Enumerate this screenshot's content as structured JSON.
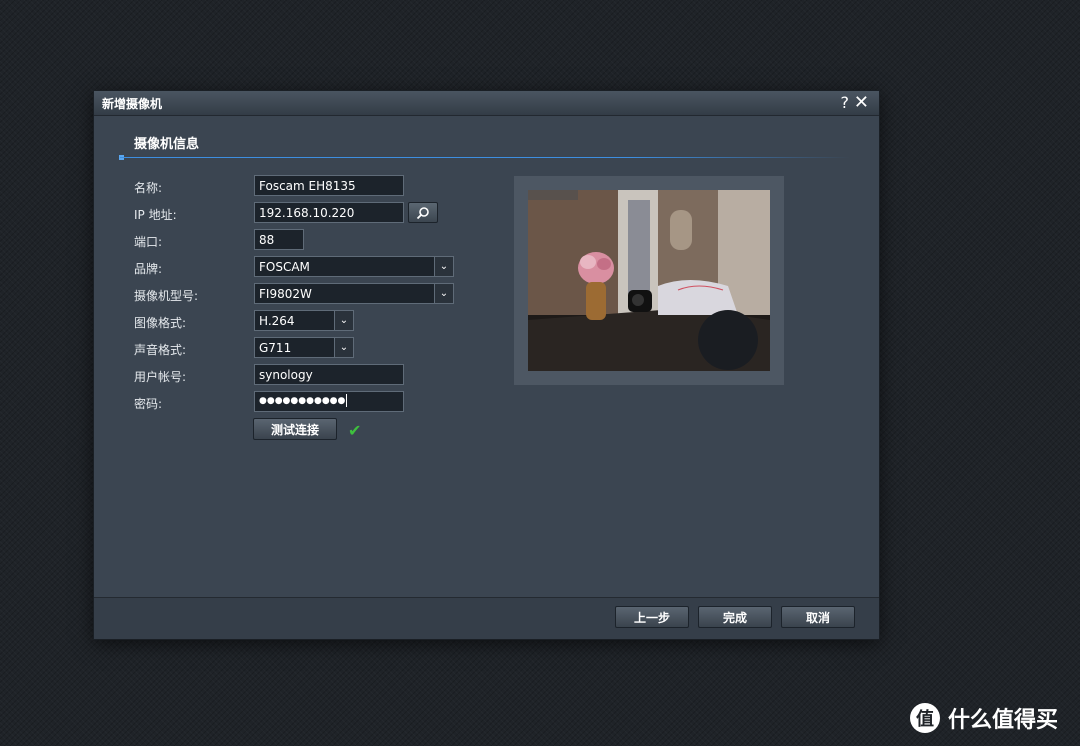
{
  "dialog": {
    "title": "新增摄像机",
    "help_icon": "?",
    "close_icon": "✕"
  },
  "section": {
    "title": "摄像机信息"
  },
  "form": {
    "name_label": "名称:",
    "name_value": "Foscam EH8135",
    "ip_label": "IP 地址:",
    "ip_value": "192.168.10.220",
    "port_label": "端口:",
    "port_value": "88",
    "brand_label": "品牌:",
    "brand_value": "FOSCAM",
    "model_label": "摄像机型号:",
    "model_value": "FI9802W",
    "video_format_label": "图像格式:",
    "video_format_value": "H.264",
    "audio_format_label": "声音格式:",
    "audio_format_value": "G711",
    "username_label": "用户帐号:",
    "username_value": "synology",
    "password_label": "密码:",
    "password_value": "●●●●●●●●●●●",
    "test_button": "测试连接",
    "test_status_icon": "✔"
  },
  "footer": {
    "prev_button": "上一步",
    "finish_button": "完成",
    "cancel_button": "取消"
  },
  "watermark": {
    "logo_char": "值",
    "text": "什么值得买"
  },
  "colors": {
    "accent": "#3d8ee0",
    "success": "#3ec03e",
    "dialog_bg": "#3b4551"
  }
}
